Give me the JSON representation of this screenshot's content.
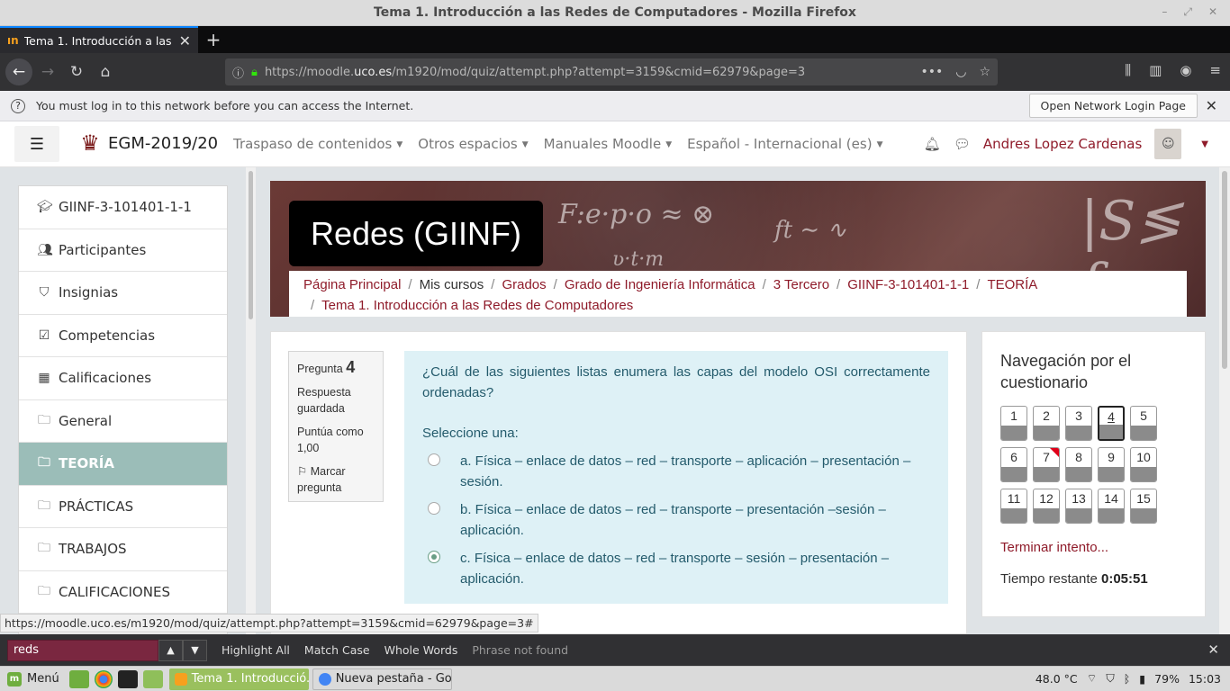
{
  "window": {
    "title": "Tema 1. Introducción a las Redes de Computadores - Mozilla Firefox"
  },
  "tabs": [
    {
      "label": "Tema 1. Introducción a las Re",
      "close": "✕"
    }
  ],
  "toolbar": {
    "url_prefix": "https://moodle.",
    "url_domain": "uco.es",
    "url_path": "/m1920/mod/quiz/attempt.php?attempt=3159&cmid=62979&page=3"
  },
  "notice": {
    "text": "You must log in to this network before you can access the Internet.",
    "button": "Open Network Login Page"
  },
  "moodle": {
    "site": "EGM-2019/20",
    "menus": [
      "Traspaso de contenidos",
      "Otros espacios",
      "Manuales Moodle",
      "Español - Internacional (es)"
    ],
    "user": "Andres Lopez Cardenas"
  },
  "drawer": {
    "items": [
      {
        "label": "GIINF-3-101401-1-1",
        "icon": "graduation-cap-icon"
      },
      {
        "label": "Participantes",
        "icon": "users-icon"
      },
      {
        "label": "Insignias",
        "icon": "shield-icon"
      },
      {
        "label": "Competencias",
        "icon": "checkbox-icon"
      },
      {
        "label": "Calificaciones",
        "icon": "table-icon"
      },
      {
        "label": "General",
        "icon": "folder-icon"
      },
      {
        "label": "TEORÍA",
        "icon": "folder-icon"
      },
      {
        "label": "PRÁCTICAS",
        "icon": "folder-icon"
      },
      {
        "label": "TRABAJOS",
        "icon": "folder-icon"
      },
      {
        "label": "CALIFICACIONES",
        "icon": "folder-icon"
      }
    ]
  },
  "course": {
    "title": "Redes (GIINF)",
    "breadcrumb": [
      "Página Principal",
      "Mis cursos",
      "Grados",
      "Grado de Ingeniería Informática",
      "3 Tercero",
      "GIINF-3-101401-1-1",
      "TEORÍA",
      "Tema 1. Introducción a las Redes de Computadores"
    ]
  },
  "question": {
    "label": "Pregunta",
    "number": "4",
    "status": "Respuesta guardada",
    "score": "Puntúa como 1,00",
    "flag": "Marcar pregunta",
    "text": "¿Cuál de las siguientes listas enumera las capas del modelo OSI correctamente ordenadas?",
    "prompt": "Seleccione una:",
    "options": [
      "a. Física – enlace de datos – red – transporte – aplicación – presentación – sesión.",
      "b. Física – enlace de datos – red – transporte – presentación –sesión –aplicación.",
      "c. Física – enlace de datos – red – transporte – sesión – presentación – aplicación."
    ],
    "selected_option": "c"
  },
  "quiz_nav": {
    "title": "Navegación por el cuestionario",
    "buttons": [
      "1",
      "2",
      "3",
      "4",
      "5",
      "6",
      "7",
      "8",
      "9",
      "10",
      "11",
      "12",
      "13",
      "14",
      "15"
    ],
    "current": "4",
    "flagged": "7",
    "finish": "Terminar intento...",
    "time_label": "Tiempo restante",
    "time_value": "0:05:51"
  },
  "status_link": "https://moodle.uco.es/m1920/mod/quiz/attempt.php?attempt=3159&cmid=62979&page=3#",
  "findbar": {
    "query": "reds",
    "highlight": "Highlight All",
    "match_case": "Match Case",
    "whole_words": "Whole Words",
    "result": "Phrase not found"
  },
  "taskbar": {
    "menu": "Menú",
    "windows": [
      "Tema 1. Introducció...",
      "Nueva pestaña - Go..."
    ],
    "temp": "48.0 °C",
    "battery": "79%",
    "clock": "15:03"
  },
  "colors": {
    "accent": "#8f1b2a",
    "active_item": "#9bbdb8",
    "question_bg": "#def1f6"
  }
}
